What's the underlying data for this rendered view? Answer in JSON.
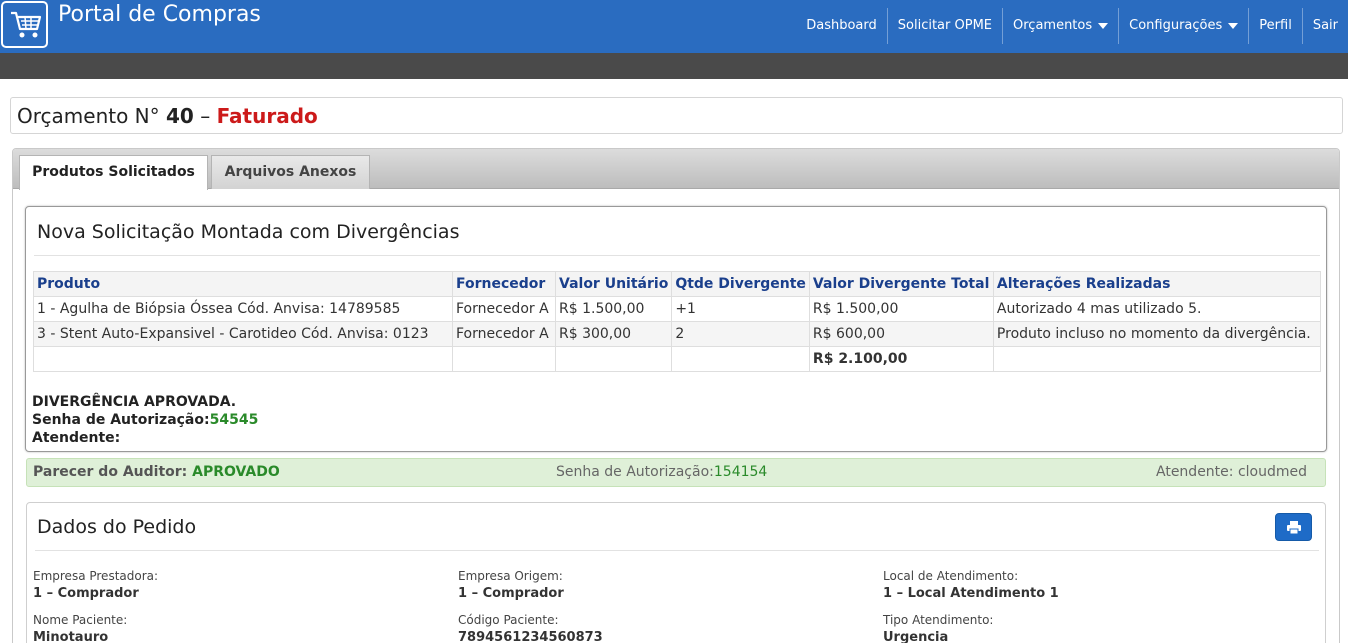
{
  "app": {
    "brand": "Portal de Compras"
  },
  "nav": {
    "items": [
      {
        "label": "Dashboard"
      },
      {
        "label": "Solicitar OPME"
      },
      {
        "label": "Orçamentos"
      },
      {
        "label": "Configurações"
      },
      {
        "label": "Perfil"
      },
      {
        "label": "Sair"
      }
    ]
  },
  "title": {
    "prefix": "Orçamento N°",
    "number": "40",
    "dash": "–",
    "status": "Faturado"
  },
  "tabs": [
    {
      "label": "Produtos Solicitados"
    },
    {
      "label": "Arquivos Anexos"
    }
  ],
  "divergence": {
    "heading": "Nova Solicitação Montada com Divergências",
    "columns": [
      "Produto",
      "Fornecedor",
      "Valor Unitário",
      "Qtde Divergente",
      "Valor Divergente Total",
      "Alterações Realizadas"
    ],
    "rows": [
      [
        "1 - Agulha de Biópsia Óssea Cód. Anvisa: 14789585",
        "Fornecedor A",
        "R$ 1.500,00",
        "+1",
        "R$ 1.500,00",
        "Autorizado 4 mas utilizado 5."
      ],
      [
        "3 - Stent Auto-Expansivel - Carotideo Cód. Anvisa: 0123",
        "Fornecedor A",
        "R$ 300,00",
        "2",
        "R$ 600,00",
        "Produto incluso no momento da divergência."
      ]
    ],
    "total": "R$ 2.100,00",
    "approved_text": "DIVERGÊNCIA APROVADA.",
    "senha_label": "Senha de Autorização:",
    "senha_value": "54545",
    "atendente_label": "Atendente:"
  },
  "auditor": {
    "parecer_label": "Parecer do Auditor:",
    "parecer_value": "APROVADO",
    "senha_label": "Senha de Autorização:",
    "senha_value": "154154",
    "atendente": "Atendente: cloudmed"
  },
  "dados": {
    "heading": "Dados do Pedido",
    "fields": [
      {
        "label": "Empresa Prestadora:",
        "value": "1 – Comprador"
      },
      {
        "label": "Empresa Origem:",
        "value": "1 – Comprador"
      },
      {
        "label": "Local de Atendimento:",
        "value": "1 – Local Atendimento 1"
      },
      {
        "label": "Nome Paciente:",
        "value": "Minotauro"
      },
      {
        "label": "Código Paciente:",
        "value": "7894561234560873"
      },
      {
        "label": "Tipo Atendimento:",
        "value": "Urgencia"
      }
    ]
  },
  "icons": {
    "logo": "shopping-cart-icon",
    "print": "print-icon"
  },
  "colors": {
    "navbar": "#2a6cc0",
    "status_red": "#cc1a1a",
    "success_green": "#2a8a2a",
    "header_blue": "#1a3f8c"
  }
}
